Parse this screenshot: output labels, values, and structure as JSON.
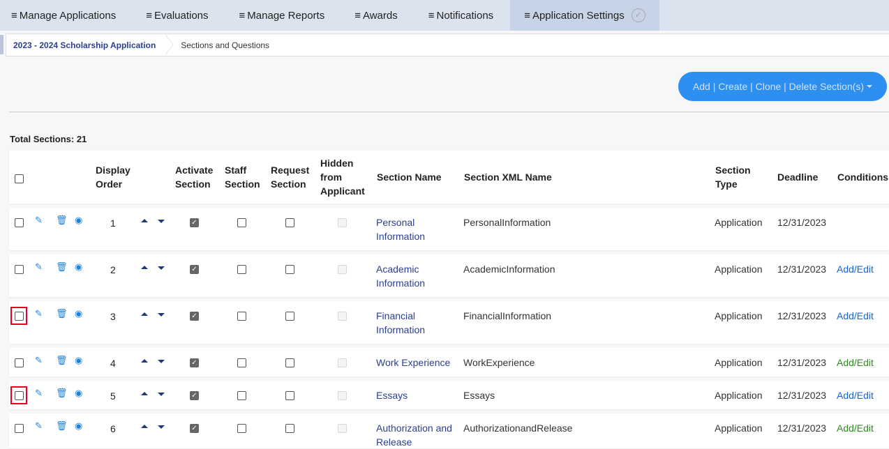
{
  "nav": {
    "items": [
      {
        "label": "Manage Applications"
      },
      {
        "label": "Evaluations"
      },
      {
        "label": "Manage Reports"
      },
      {
        "label": "Awards"
      },
      {
        "label": "Notifications"
      },
      {
        "label": "Application Settings",
        "active": true
      }
    ],
    "menu_icon": "≡",
    "check_icon": "✓"
  },
  "breadcrumb": {
    "program": "2023 - 2024 Scholarship Application",
    "current": "Sections and Questions"
  },
  "actions": {
    "menu_label": "Add | Create | Clone | Delete Section(s)"
  },
  "total_sections": "Total Sections: 21",
  "table": {
    "headers": {
      "display_order": [
        "Display",
        "Order"
      ],
      "activate_section": [
        "Activate",
        "Section"
      ],
      "staff_section": [
        "Staff",
        "Section"
      ],
      "request_section": [
        "Request",
        "Section"
      ],
      "hidden_from_applicant": [
        "Hidden",
        "from",
        "Applicant"
      ],
      "section_name": "Section Name",
      "section_xml_name": "Section XML Name",
      "section_type": [
        "Section",
        "Type"
      ],
      "deadline": "Deadline",
      "conditions": "Conditions"
    },
    "rows": [
      {
        "order": "1",
        "name": [
          "Personal",
          "Information"
        ],
        "xml": "PersonalInformation",
        "type": "Application",
        "deadline": "12/31/2023",
        "condition": "",
        "condition_color": "",
        "highlight": false
      },
      {
        "order": "2",
        "name": [
          "Academic",
          "Information"
        ],
        "xml": "AcademicInformation",
        "type": "Application",
        "deadline": "12/31/2023",
        "condition": "Add/Edit",
        "condition_color": "blue",
        "highlight": false
      },
      {
        "order": "3",
        "name": [
          "Financial",
          "Information"
        ],
        "xml": "FinancialInformation",
        "type": "Application",
        "deadline": "12/31/2023",
        "condition": "Add/Edit",
        "condition_color": "blue",
        "highlight": true
      },
      {
        "order": "4",
        "name": [
          "Work Experience"
        ],
        "xml": "WorkExperience",
        "type": "Application",
        "deadline": "12/31/2023",
        "condition": "Add/Edit",
        "condition_color": "green",
        "highlight": false
      },
      {
        "order": "5",
        "name": [
          "Essays"
        ],
        "xml": "Essays",
        "type": "Application",
        "deadline": "12/31/2023",
        "condition": "Add/Edit",
        "condition_color": "blue",
        "highlight": true
      },
      {
        "order": "6",
        "name": [
          "Authorization and",
          "Release"
        ],
        "xml": "AuthorizationandRelease",
        "type": "Application",
        "deadline": "12/31/2023",
        "condition": "Add/Edit",
        "condition_color": "green",
        "highlight": false
      }
    ],
    "icons": {
      "edit": "edit-icon",
      "delete": "trash-icon",
      "view": "eye-icon"
    }
  }
}
